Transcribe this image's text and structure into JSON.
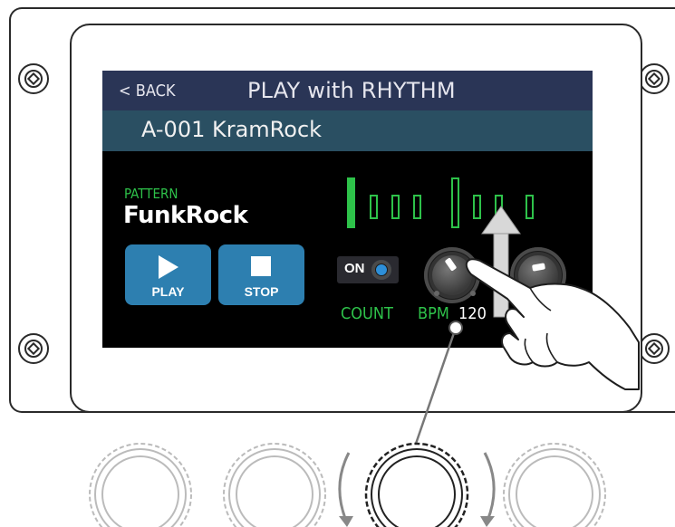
{
  "screen": {
    "back_label": "< BACK",
    "title": "PLAY with RHYTHM",
    "patch_name": "A-001 KramRock",
    "pattern_label": "PATTERN",
    "pattern_value": "FunkRock",
    "play_label": "PLAY",
    "stop_label": "STOP",
    "count_toggle": "ON",
    "count_label": "COUNT",
    "bpm_label": "BPM",
    "bpm_value": "120"
  },
  "colors": {
    "title_bar": "#2a3556",
    "patch_bar": "#2a4f62",
    "accent_green": "#2ec24a",
    "button_blue": "#2d7fb0",
    "toggle_blue": "#2d8fd8"
  },
  "beat_indicator": {
    "beats": 8,
    "current_beat": 1,
    "accent_beats": [
      1,
      5
    ]
  },
  "icons": [
    "play-icon",
    "stop-icon",
    "screw-icon",
    "hand-pointer-icon",
    "up-arrow-icon",
    "rotate-arrow-icon"
  ]
}
